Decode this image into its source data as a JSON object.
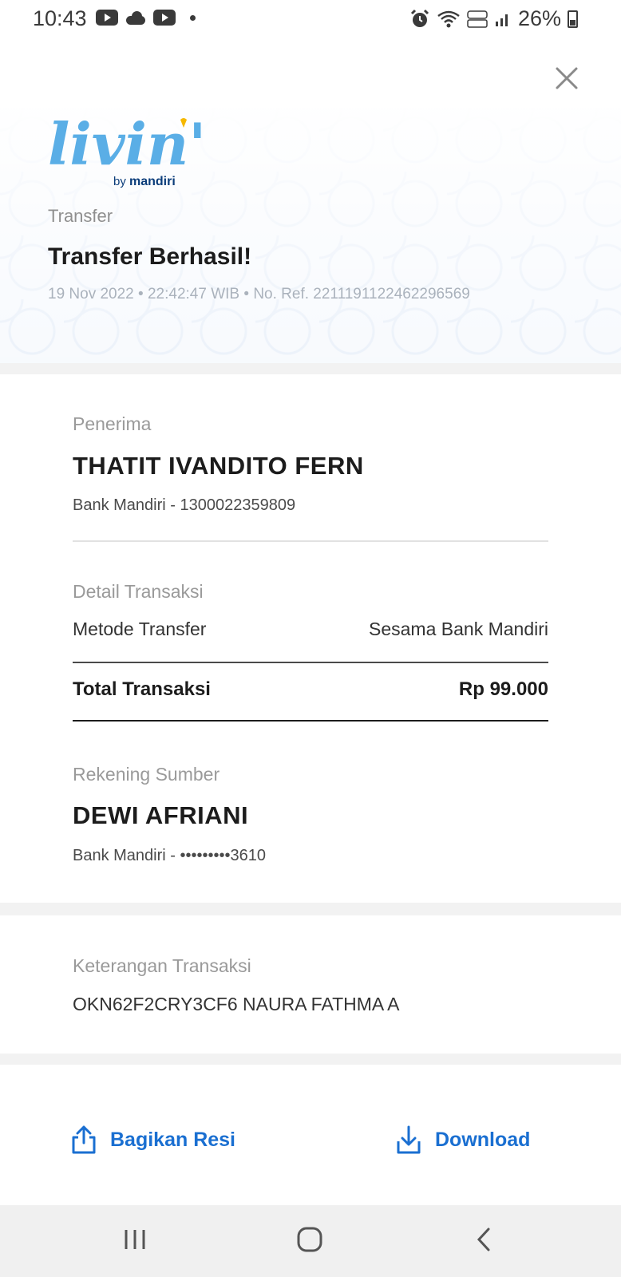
{
  "status_bar": {
    "time": "10:43",
    "battery": "26%"
  },
  "header": {
    "logo_text": "livin'",
    "logo_subtext_by": "by",
    "logo_subtext_brand": "mandiri",
    "section_label": "Transfer",
    "title": "Transfer Berhasil!",
    "date": "19 Nov 2022",
    "time": "22:42:47 WIB",
    "reference": "No. Ref. 2211191122462296569",
    "separator": "•"
  },
  "recipient": {
    "label": "Penerima",
    "name": "THATIT IVANDITO FERN",
    "account": "Bank Mandiri - 1300022359809"
  },
  "transaction_detail": {
    "label": "Detail Transaksi",
    "method_label": "Metode Transfer",
    "method_value": "Sesama Bank Mandiri",
    "total_label": "Total Transaksi",
    "total_value": "Rp 99.000"
  },
  "source_account": {
    "label": "Rekening Sumber",
    "name": "DEWI AFRIANI",
    "account": "Bank Mandiri - •••••••••3610"
  },
  "notes": {
    "label": "Keterangan Transaksi",
    "value": "OKN62F2CRY3CF6 NAURA FATHMA A"
  },
  "actions": {
    "share_label": "Bagikan Resi",
    "download_label": "Download"
  },
  "colors": {
    "accent": "#1a6fd1",
    "logo_blue": "#5aaee6",
    "logo_yellow": "#f6b800",
    "brand_navy": "#0b3d7a"
  }
}
